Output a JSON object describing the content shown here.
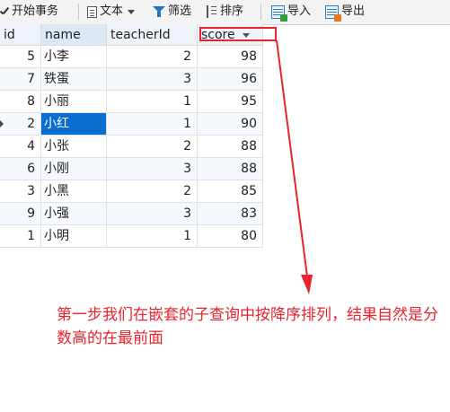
{
  "toolbar": {
    "begin_transaction": "开始事务",
    "text": "文本",
    "filter": "筛选",
    "sort": "排序",
    "import": "导入",
    "export": "导出"
  },
  "grid": {
    "columns": [
      "id",
      "name",
      "teacherId",
      "score"
    ],
    "rows": [
      {
        "id": "5",
        "name": "小李",
        "teacherId": "2",
        "score": "98"
      },
      {
        "id": "7",
        "name": "铁蛋",
        "teacherId": "3",
        "score": "96"
      },
      {
        "id": "8",
        "name": "小丽",
        "teacherId": "1",
        "score": "95"
      },
      {
        "id": "2",
        "name": "小红",
        "teacherId": "1",
        "score": "90"
      },
      {
        "id": "4",
        "name": "小张",
        "teacherId": "2",
        "score": "88"
      },
      {
        "id": "6",
        "name": "小刚",
        "teacherId": "3",
        "score": "88"
      },
      {
        "id": "3",
        "name": "小黑",
        "teacherId": "2",
        "score": "85"
      },
      {
        "id": "9",
        "name": "小强",
        "teacherId": "3",
        "score": "83"
      },
      {
        "id": "1",
        "name": "小明",
        "teacherId": "1",
        "score": "80"
      }
    ],
    "selected_row": 3
  },
  "annotation": "第一步我们在嵌套的子查询中按降序排列，结果自然是分数高的在最前面",
  "colors": {
    "annotation": "#e8232c",
    "selection": "#0a6ed1"
  }
}
